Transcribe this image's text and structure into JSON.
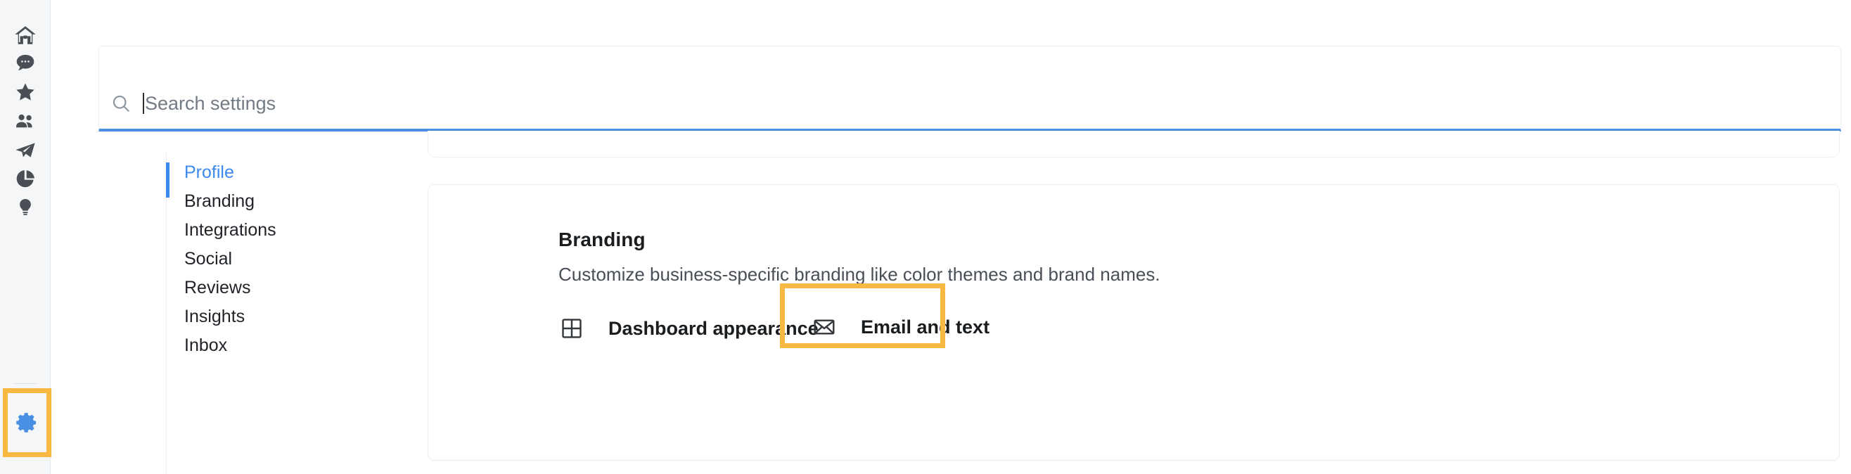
{
  "rail": {
    "items": [
      {
        "name": "home-icon",
        "label": "Home"
      },
      {
        "name": "chat-icon",
        "label": "Messages"
      },
      {
        "name": "star-icon",
        "label": "Favorites"
      },
      {
        "name": "people-icon",
        "label": "Contacts"
      },
      {
        "name": "send-icon",
        "label": "Campaigns"
      },
      {
        "name": "pie-chart-icon",
        "label": "Reports"
      },
      {
        "name": "lightbulb-icon",
        "label": "Ideas"
      }
    ],
    "settings": {
      "name": "gear-icon",
      "label": "Settings",
      "active": true,
      "color": "#4a90e2"
    },
    "highlight_color": "#f7b942"
  },
  "search": {
    "placeholder": "Search settings",
    "value": "",
    "icon": "search-icon",
    "focus_color": "#4a90e2"
  },
  "settings_nav": {
    "active_color": "#3b8bee",
    "items": [
      {
        "label": "Profile",
        "active": true
      },
      {
        "label": "Branding",
        "active": false
      },
      {
        "label": "Integrations",
        "active": false
      },
      {
        "label": "Social",
        "active": false
      },
      {
        "label": "Reviews",
        "active": false
      },
      {
        "label": "Insights",
        "active": false
      },
      {
        "label": "Inbox",
        "active": false
      }
    ]
  },
  "branding": {
    "title": "Branding",
    "description": "Customize business-specific branding like color themes and brand names.",
    "tiles": [
      {
        "label": "Dashboard appearance",
        "icon": "grid-icon",
        "highlighted": false
      },
      {
        "label": "Email and text",
        "icon": "envelope-icon",
        "highlighted": true
      }
    ],
    "highlight_color": "#f7b942"
  }
}
